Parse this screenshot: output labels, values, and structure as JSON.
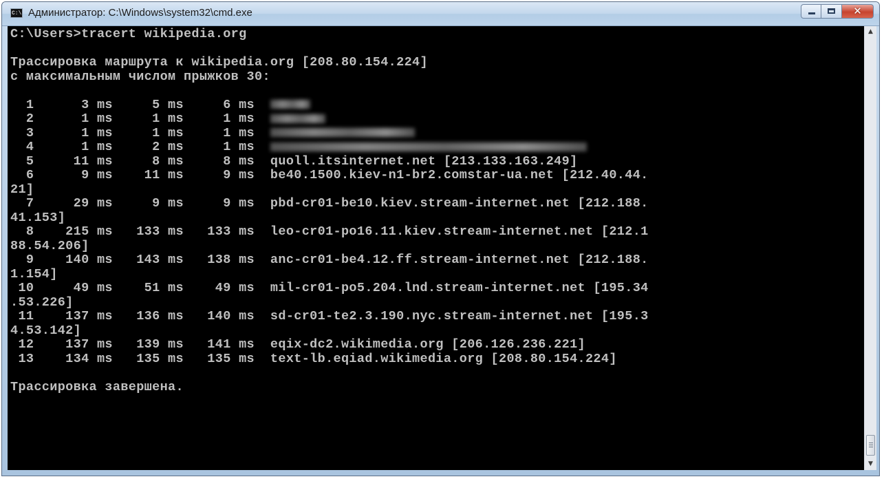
{
  "window": {
    "title": "Администратор: C:\\Windows\\system32\\cmd.exe",
    "icon": "cmd-icon",
    "icon_label": "C:\\",
    "close_glyph": "✕"
  },
  "console": {
    "lines": [
      "C:\\Users>tracert wikipedia.org",
      "",
      "Трассировка маршрута к wikipedia.org [208.80.154.224]",
      "с максимальным числом прыжков 30:",
      "",
      "  1      3 ms     5 ms     6 ms  ",
      "  2      1 ms     1 ms     1 ms  ",
      "  3      1 ms     1 ms     1 ms  ",
      "  4      1 ms     2 ms     1 ms  ",
      "  5     11 ms     8 ms     8 ms  quoll.itsinternet.net [213.133.163.249]",
      "  6      9 ms    11 ms     9 ms  be40.1500.kiev-n1-br2.comstar-ua.net [212.40.44.",
      "21]",
      "  7     29 ms     9 ms     9 ms  pbd-cr01-be10.kiev.stream-internet.net [212.188.",
      "41.153]",
      "  8    215 ms   133 ms   133 ms  leo-cr01-po16.11.kiev.stream-internet.net [212.1",
      "88.54.206]",
      "  9    140 ms   143 ms   138 ms  anc-cr01-be4.12.ff.stream-internet.net [212.188.",
      "1.154]",
      " 10     49 ms    51 ms    49 ms  mil-cr01-po5.204.lnd.stream-internet.net [195.34",
      ".53.226]",
      " 11    137 ms   136 ms   140 ms  sd-cr01-te2.3.190.nyc.stream-internet.net [195.3",
      "4.53.142]",
      " 12    137 ms   139 ms   141 ms  eqix-dc2.wikimedia.org [206.126.236.221]",
      " 13    134 ms   135 ms   135 ms  text-lb.eqiad.wikimedia.org [208.80.154.224]",
      "",
      "Трассировка завершена."
    ]
  },
  "scrollbar": {
    "up_arrow": "▲",
    "down_arrow": "▼"
  },
  "colors": {
    "console_background": "#000000",
    "console_text": "#c0c0c0",
    "titlebar": "#c2d7ec",
    "close_button": "#c7442f"
  }
}
